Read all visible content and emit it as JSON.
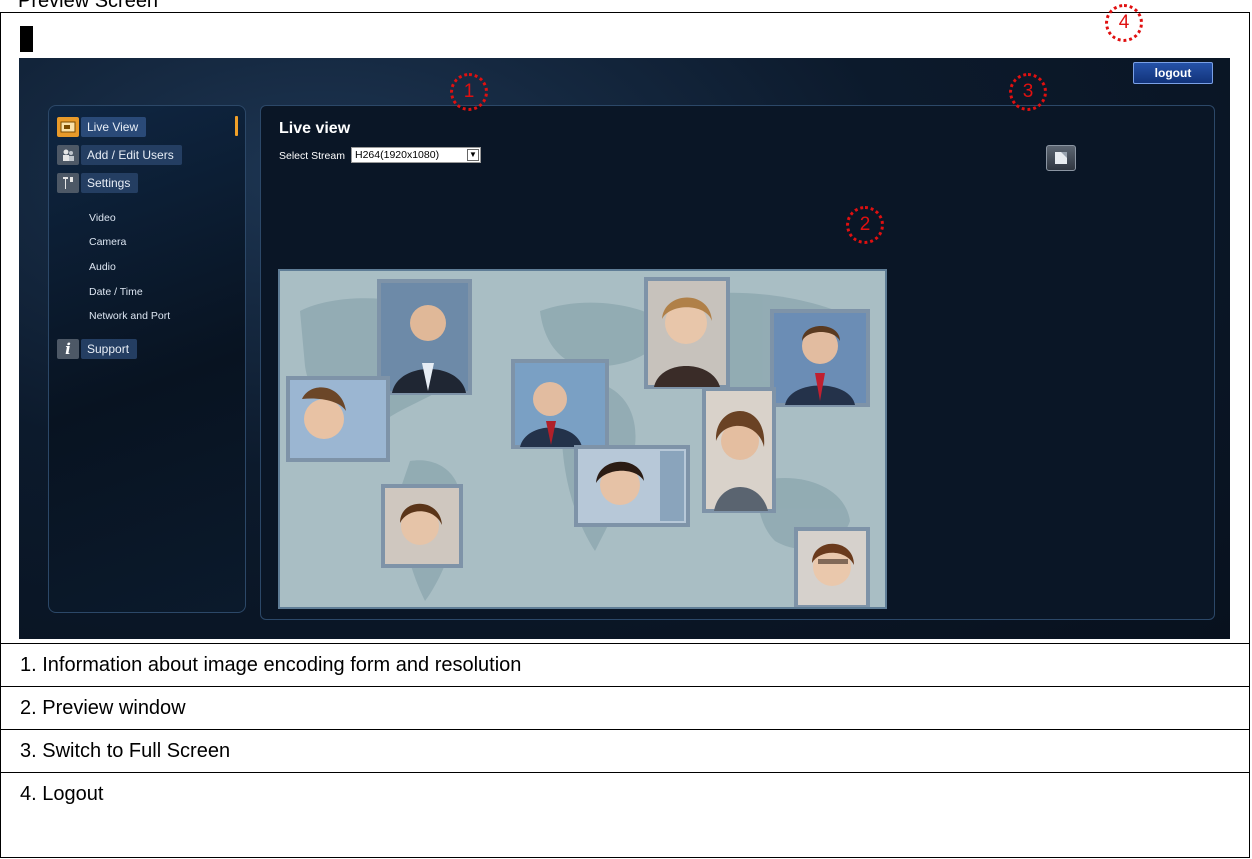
{
  "doc": {
    "title": "Preview Screen"
  },
  "app": {
    "logout_label": "logout",
    "accent_color": "#f1a028",
    "background_color": "#0b1a2c"
  },
  "sidebar": {
    "items": [
      {
        "label": "Live View",
        "icon": "live-view-icon"
      },
      {
        "label": "Add / Edit Users",
        "icon": "users-icon"
      },
      {
        "label": "Settings",
        "icon": "settings-icon"
      },
      {
        "label": "Support",
        "icon": "info-icon"
      }
    ],
    "settings_subitems": [
      "Video",
      "Camera",
      "Audio",
      "Date / Time",
      "Network and Port"
    ]
  },
  "main": {
    "title": "Live view",
    "stream_label": "Select Stream",
    "stream_value": "H264(1920x1080)",
    "fullscreen_icon": "fullscreen-icon"
  },
  "callouts": [
    "1",
    "2",
    "3",
    "4"
  ],
  "legend": [
    "1. Information about image encoding form and resolution",
    "2. Preview window",
    "3. Switch to Full Screen",
    "4. Logout"
  ]
}
